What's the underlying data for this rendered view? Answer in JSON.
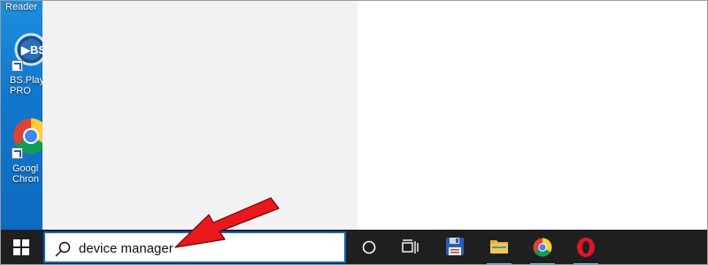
{
  "desktop": {
    "icons": [
      {
        "label": "Reader",
        "icon": "reader-icon"
      },
      {
        "label": "BS.Playe\nPRO",
        "icon": "bsplayer-icon"
      },
      {
        "label": "Googl\nChron",
        "icon": "chrome-icon"
      }
    ]
  },
  "taskbar": {
    "search_value": "device manager",
    "icons": [
      "windows-start-icon",
      "cortana-icon",
      "task-view-icon",
      "save-floppy-icon",
      "file-explorer-icon",
      "chrome-icon",
      "opera-icon"
    ]
  },
  "colors": {
    "taskbar": "#1f1f1f",
    "search_border": "#0a64c8",
    "desktop": "#1178cf",
    "annotation_arrow": "#e8181c"
  }
}
